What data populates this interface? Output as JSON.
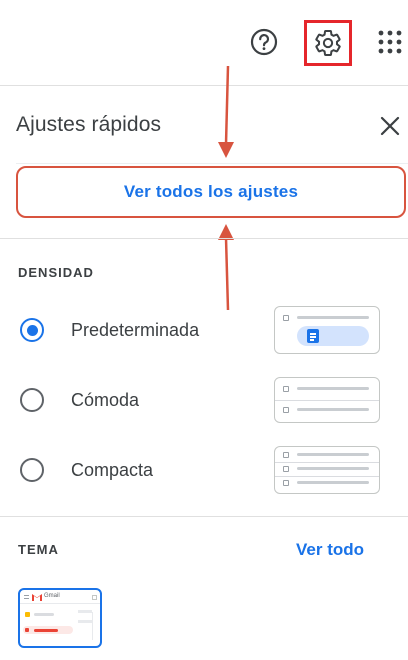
{
  "topbar": {
    "help_icon": "help-circle-icon",
    "settings_icon": "gear-icon",
    "apps_icon": "apps-grid-icon"
  },
  "panel": {
    "title": "Ajustes rápidos",
    "close_icon": "close-icon",
    "all_settings_label": "Ver todos los ajustes"
  },
  "density": {
    "heading": "DENSIDAD",
    "options": [
      {
        "label": "Predeterminada",
        "selected": true
      },
      {
        "label": "Cómoda",
        "selected": false
      },
      {
        "label": "Compacta",
        "selected": false
      }
    ]
  },
  "theme": {
    "heading": "TEMA",
    "see_all_label": "Ver todo",
    "thumbnail_brand_text": "Gmail"
  },
  "colors": {
    "accent": "#1a73e8",
    "highlight_box": "#e5262b",
    "annotation_arrow": "#d8543f",
    "text": "#3c4043"
  }
}
